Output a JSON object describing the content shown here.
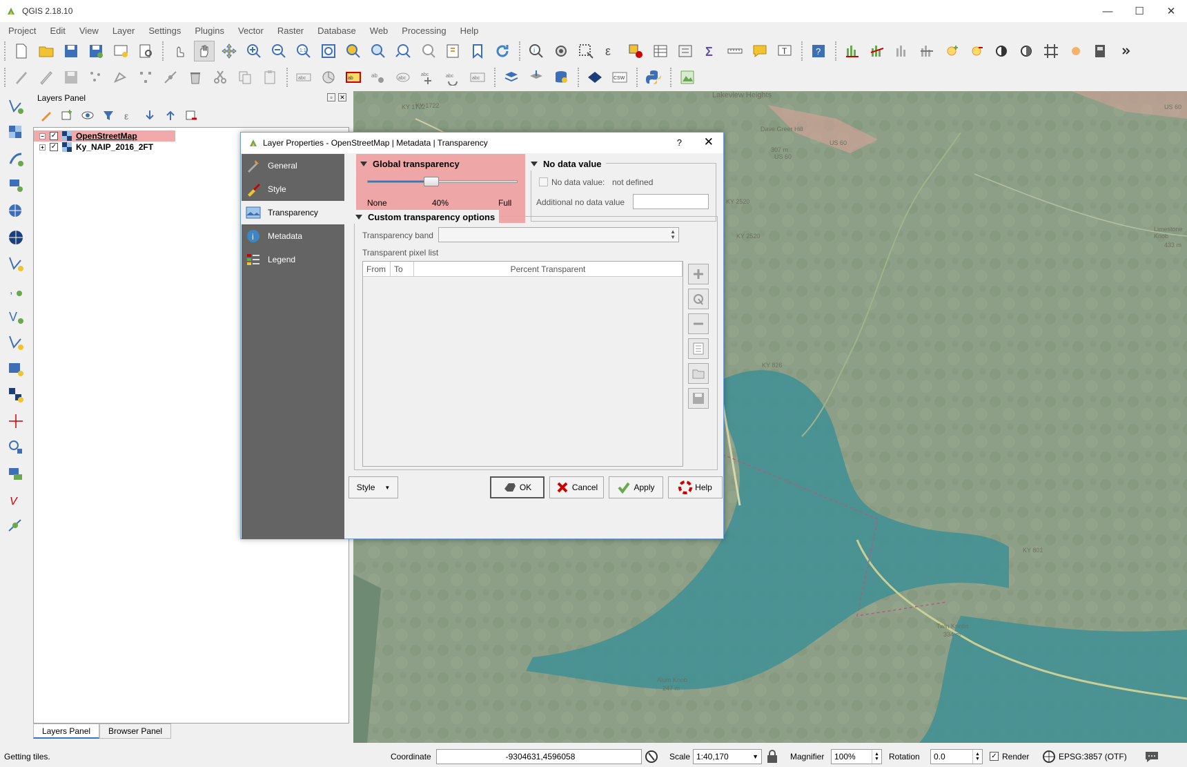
{
  "window": {
    "title": "QGIS 2.18.10"
  },
  "menu": [
    "Project",
    "Edit",
    "View",
    "Layer",
    "Settings",
    "Plugins",
    "Vector",
    "Raster",
    "Database",
    "Web",
    "Processing",
    "Help"
  ],
  "layers_panel": {
    "title": "Layers Panel",
    "layers": [
      {
        "name": "OpenStreetMap",
        "checked": "✓",
        "highlighted": true
      },
      {
        "name": "Ky_NAIP_2016_2FT",
        "checked": "✓",
        "highlighted": false
      }
    ],
    "tabs": [
      "Layers Panel",
      "Browser Panel"
    ]
  },
  "dialog": {
    "title": "Layer Properties - OpenStreetMap | Metadata | Transparency",
    "help_glyph": "?",
    "close_glyph": "✕",
    "nav": [
      "General",
      "Style",
      "Transparency",
      "Metadata",
      "Legend"
    ],
    "global_transparency": {
      "title": "Global transparency",
      "value_label": "40%",
      "min_label": "None",
      "max_label": "Full",
      "value": 0.4
    },
    "no_data": {
      "title": "No data value",
      "checkbox_label": "No data value:",
      "value_text": "not defined",
      "additional_label": "Additional no data value",
      "additional_value": ""
    },
    "custom": {
      "title": "Custom transparency options",
      "band_label": "Transparency band",
      "band_value": "",
      "pixel_list_label": "Transparent pixel list",
      "columns": [
        "From",
        "To",
        "Percent Transparent"
      ]
    },
    "style_button": "Style",
    "buttons": {
      "ok": "OK",
      "cancel": "Cancel",
      "apply": "Apply",
      "help": "Help"
    }
  },
  "map": {
    "labels": [
      "KY 1722",
      "KY 1722",
      "Lakeview Heights",
      "US 60",
      "Dave Greer Hill",
      "307 m",
      "US 60",
      "US 60",
      "KY 2520",
      "KY 2520",
      "KY 826",
      "Limestone Knob",
      "433 m",
      "KY 801",
      "Twin Knobs",
      "334 m",
      "Alum Knob",
      "247 m"
    ]
  },
  "status": {
    "message": "Getting tiles.",
    "coordinate_label": "Coordinate",
    "coordinate_value": "-9304631,4596058",
    "scale_label": "Scale",
    "scale_value": "1:40,170",
    "magnifier_label": "Magnifier",
    "magnifier_value": "100%",
    "rotation_label": "Rotation",
    "rotation_value": "0.0",
    "render_label": "Render",
    "render_checked": "✓",
    "crs": "EPSG:3857 (OTF)"
  },
  "colors": {
    "highlight": "#efa6a6",
    "nav_bg": "#646464",
    "accent": "#3575c4"
  }
}
